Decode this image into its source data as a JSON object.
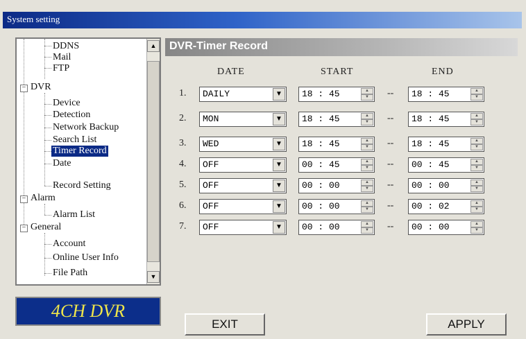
{
  "window": {
    "title": "System setting"
  },
  "tree": {
    "items": [
      {
        "label": "DDNS"
      },
      {
        "label": "Mail"
      },
      {
        "label": "FTP"
      },
      {
        "label": "DVR",
        "expander": "−"
      },
      {
        "label": "Device"
      },
      {
        "label": "Detection"
      },
      {
        "label": "Network Backup"
      },
      {
        "label": "Search List"
      },
      {
        "label": "Timer Record"
      },
      {
        "label": "Date"
      },
      {
        "label": "Record Setting"
      },
      {
        "label": "Alarm",
        "expander": "−"
      },
      {
        "label": "Alarm List"
      },
      {
        "label": "General",
        "expander": "−"
      },
      {
        "label": "Account"
      },
      {
        "label": "Online User Info"
      },
      {
        "label": "File Path"
      }
    ]
  },
  "logo": {
    "text": "4CH DVR"
  },
  "panel": {
    "title": "DVR-Timer Record",
    "columns": {
      "date": "DATE",
      "start": "START",
      "end": "END"
    },
    "separator": "--",
    "rows": [
      {
        "num": "1.",
        "date": "DAILY",
        "start": "18 : 45",
        "end": "18 : 45"
      },
      {
        "num": "2.",
        "date": "MON",
        "start": "18 : 45",
        "end": "18 : 45"
      },
      {
        "num": "3.",
        "date": "WED",
        "start": "18 : 45",
        "end": "18 : 45"
      },
      {
        "num": "4.",
        "date": "OFF",
        "start": "00 : 45",
        "end": "00 : 45"
      },
      {
        "num": "5.",
        "date": "OFF",
        "start": "00 : 00",
        "end": "00 : 00"
      },
      {
        "num": "6.",
        "date": "OFF",
        "start": "00 : 00",
        "end": "00 : 02"
      },
      {
        "num": "7.",
        "date": "OFF",
        "start": "00 : 00",
        "end": "00 : 00"
      }
    ]
  },
  "buttons": {
    "exit": "EXIT",
    "apply": "APPLY"
  }
}
